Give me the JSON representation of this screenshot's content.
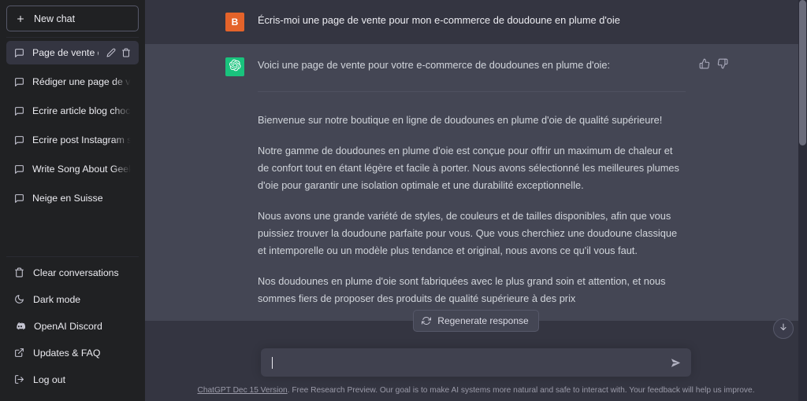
{
  "sidebar": {
    "new_chat_label": "New chat",
    "new_chat_icon": "plus-icon",
    "conversations": [
      {
        "label": "Page de vente doudou",
        "icon": "message-icon",
        "active": true,
        "edit_icon": "pencil-icon",
        "delete_icon": "trash-icon"
      },
      {
        "label": "Rédiger une page de vente p",
        "icon": "message-icon",
        "active": false
      },
      {
        "label": "Ecrire article blog chocolat su",
        "icon": "message-icon",
        "active": false
      },
      {
        "label": "Ecrire post Instagram sur les",
        "icon": "message-icon",
        "active": false
      },
      {
        "label": "Write Song About Geekworke",
        "icon": "message-icon",
        "active": false
      },
      {
        "label": "Neige en Suisse",
        "icon": "message-icon",
        "active": false
      }
    ],
    "footer_items": [
      {
        "label": "Clear conversations",
        "icon": "trash-icon"
      },
      {
        "label": "Dark mode",
        "icon": "moon-icon"
      },
      {
        "label": "OpenAI Discord",
        "icon": "discord-icon"
      },
      {
        "label": "Updates & FAQ",
        "icon": "external-link-icon"
      },
      {
        "label": "Log out",
        "icon": "logout-icon"
      }
    ]
  },
  "conversation": {
    "user_message": {
      "avatar_initial": "B",
      "avatar_color": "#e4632a",
      "text": "Écris-moi une page de vente pour mon e-commerce de doudoune en plume d'oie"
    },
    "assistant_message": {
      "avatar_icon": "openai-logo-icon",
      "avatar_color": "#19c37d",
      "intro": "Voici une page de vente pour votre e-commerce de doudounes en plume d'oie:",
      "paragraphs": [
        "Bienvenue sur notre boutique en ligne de doudounes en plume d'oie de qualité supérieure!",
        "Notre gamme de doudounes en plume d'oie est conçue pour offrir un maximum de chaleur et de confort tout en étant légère et facile à porter. Nous avons sélectionné les meilleures plumes d'oie pour garantir une isolation optimale et une durabilité exceptionnelle.",
        "Nous avons une grande variété de styles, de couleurs et de tailles disponibles, afin que vous puissiez trouver la doudoune parfaite pour vous. Que vous cherchiez une doudoune classique et intemporelle ou un modèle plus tendance et original, nous avons ce qu'il vous faut.",
        "Nos doudounes en plume d'oie sont fabriquées avec le plus grand soin et attention, et nous sommes fiers de proposer des produits de qualité supérieure à des prix"
      ],
      "feedback": {
        "thumbs_up_icon": "thumbs-up-icon",
        "thumbs_down_icon": "thumbs-down-icon"
      }
    }
  },
  "actions": {
    "regenerate_label": "Regenerate response",
    "regenerate_icon": "refresh-icon",
    "scroll_to_bottom_icon": "arrow-down-icon"
  },
  "composer": {
    "value": "",
    "placeholder": "",
    "send_icon": "send-arrow-icon"
  },
  "footer": {
    "version_link": "ChatGPT Dec 15 Version",
    "disclaimer": ". Free Research Preview. Our goal is to make AI systems more natural and safe to interact with. Your feedback will help us improve."
  }
}
